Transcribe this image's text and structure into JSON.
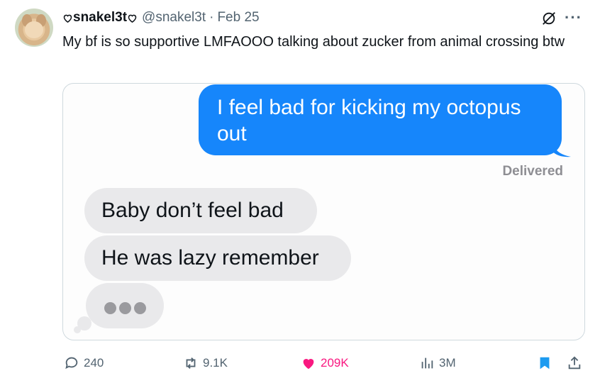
{
  "author": {
    "display_name": "snakel3t",
    "handle": "@snakel3t",
    "separator": "·",
    "date": "Feb 25"
  },
  "tweet": {
    "text": "My bf is so supportive LMFAOOO talking about zucker from animal crossing btw"
  },
  "media": {
    "sent_message": "I feel bad for kicking my octopus out",
    "status": "Delivered",
    "received_messages": [
      "Baby don’t feel bad",
      "He was lazy remember"
    ],
    "typing_indicator": "•••"
  },
  "actions": {
    "replies": "240",
    "reposts": "9.1K",
    "likes": "209K",
    "views": "3M"
  },
  "colors": {
    "imessage_blue": "#1686fb",
    "received_gray": "#e9e9eb",
    "like_pink": "#f91880",
    "muted": "#536471"
  }
}
